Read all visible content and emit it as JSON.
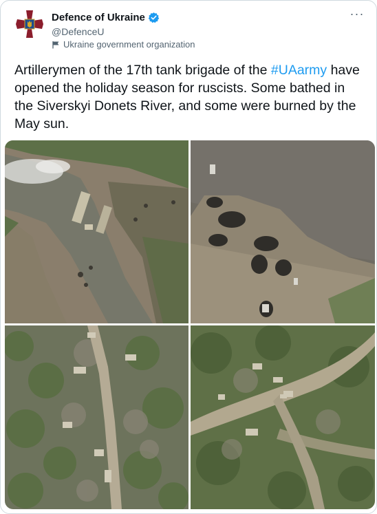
{
  "account": {
    "name": "Defence of Ukraine",
    "handle": "@DefenceU",
    "label": "Ukraine government organization",
    "avatar_icon": "ministry-of-defence-emblem-icon",
    "verified_icon": "verified-badge-icon",
    "label_icon": "flag-icon"
  },
  "tweet": {
    "text_before": "Artillerymen of the 17th tank brigade of the ",
    "hashtag": "#UAarmy",
    "text_after": " have opened the holiday season for ruscists. Some bathed in the Siverskyi Donets River, and some were burned by the May sun."
  },
  "more_button": "···",
  "colors": {
    "link": "#1d9bf0",
    "text": "#0f1419",
    "secondary": "#536471",
    "border": "#cfd9de",
    "avatar_red": "#8b1d2c"
  }
}
